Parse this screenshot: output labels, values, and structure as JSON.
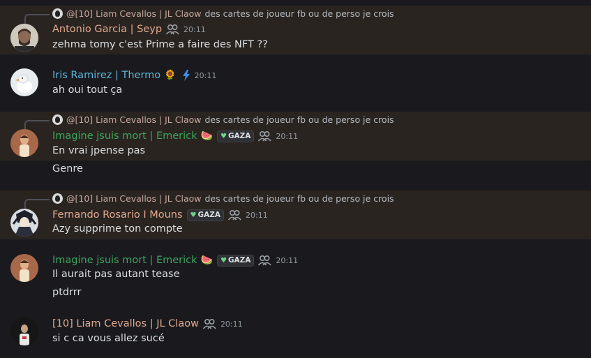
{
  "reply_target": {
    "name": "@[10] Liam Cevallos | JL Claow",
    "text": "des cartes de joueur fb ou de perso je crois"
  },
  "messages": [
    {
      "author": "Antonio Garcia | Seyp",
      "author_color": "#e0a98f",
      "time": "20:11",
      "lines": [
        "zehma tomy c'est Prime a faire des NFT ??"
      ]
    },
    {
      "author": "Iris Ramirez | Thermo",
      "author_color": "#5fb4d9",
      "emoji": "🌻",
      "badge_icon": "lightning-icon",
      "time": "20:11",
      "lines": [
        "ah oui tout ça"
      ]
    },
    {
      "author": "Imagine jsuis mort | Emerick",
      "author_color": "#3ba55c",
      "emoji": "🍉",
      "tag": "GAZA",
      "time": "20:11",
      "lines": [
        "En vrai jpense pas",
        "Genre"
      ]
    },
    {
      "author": "Fernando Rosario I Mouns",
      "author_color": "#e0a98f",
      "tag": "GAZA",
      "time": "20:11",
      "lines": [
        "Azy supprime ton compte"
      ]
    },
    {
      "author": "Imagine jsuis mort | Emerick",
      "author_color": "#3ba55c",
      "emoji": "🍉",
      "tag": "GAZA",
      "time": "20:11",
      "lines": [
        "Il aurait pas autant tease",
        "ptdrrr"
      ]
    },
    {
      "author": "[10] Liam Cevallos | JL Claow",
      "author_color": "#e0a98f",
      "time": "20:11",
      "lines": [
        "si c ca vous allez sucé"
      ]
    }
  ],
  "colors": {
    "background": "#1a1a1e",
    "highlight": "#2a2420",
    "text": "#dbdee1",
    "timestamp": "#949ba4"
  }
}
